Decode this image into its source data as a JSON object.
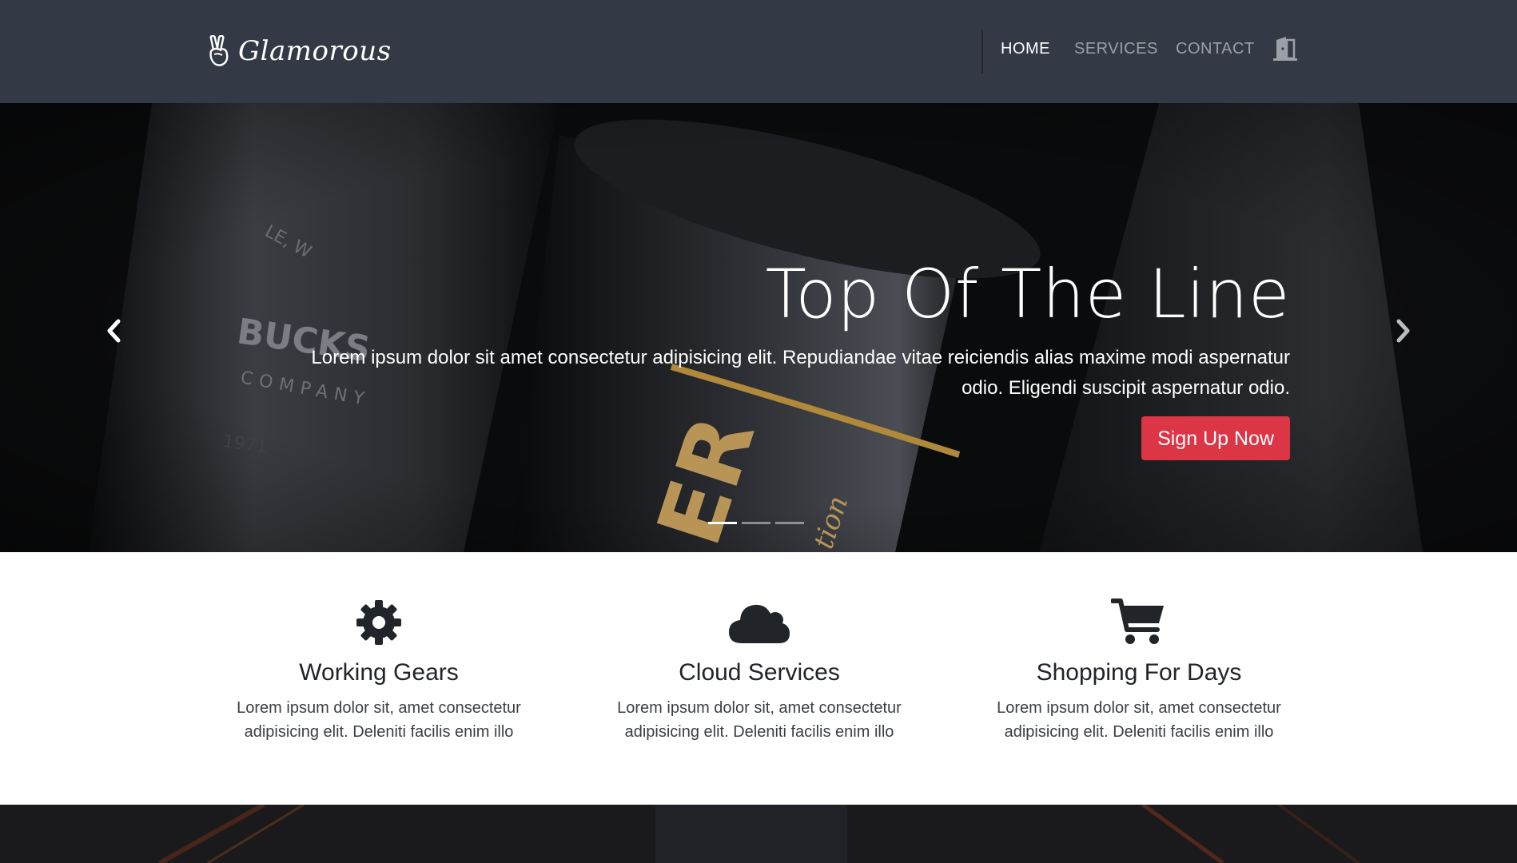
{
  "brand": {
    "name": "Glamorous"
  },
  "nav": {
    "home": "HOME",
    "services": "SERVICES",
    "contact": "CONTACT"
  },
  "hero": {
    "title": "Top Of The Line",
    "text": "Lorem ipsum dolor sit amet consectetur adipisicing elit. Repudiandae vitae reiciendis alias maxime modi aspernatur odio. Eligendi suscipit aspernatur odio.",
    "cta": "Sign Up Now",
    "slides": 3,
    "active_slide": 1,
    "background_text": [
      "LE, W",
      "BUCKS",
      "COMPANY",
      "1971",
      "ER",
      "tion"
    ]
  },
  "features": [
    {
      "icon": "gear-icon",
      "title": "Working Gears",
      "desc": "Lorem ipsum dolor sit, amet consectetur adipisicing elit. Deleniti facilis enim illo"
    },
    {
      "icon": "cloud-icon",
      "title": "Cloud Services",
      "desc": "Lorem ipsum dolor sit, amet consectetur adipisicing elit. Deleniti facilis enim illo"
    },
    {
      "icon": "cart-icon",
      "title": "Shopping For Days",
      "desc": "Lorem ipsum dolor sit, amet consectetur adipisicing elit. Deleniti facilis enim illo"
    }
  ],
  "colors": {
    "navbar_bg": "#343a45",
    "accent_red": "#dc3545",
    "text_dark": "#212529"
  }
}
